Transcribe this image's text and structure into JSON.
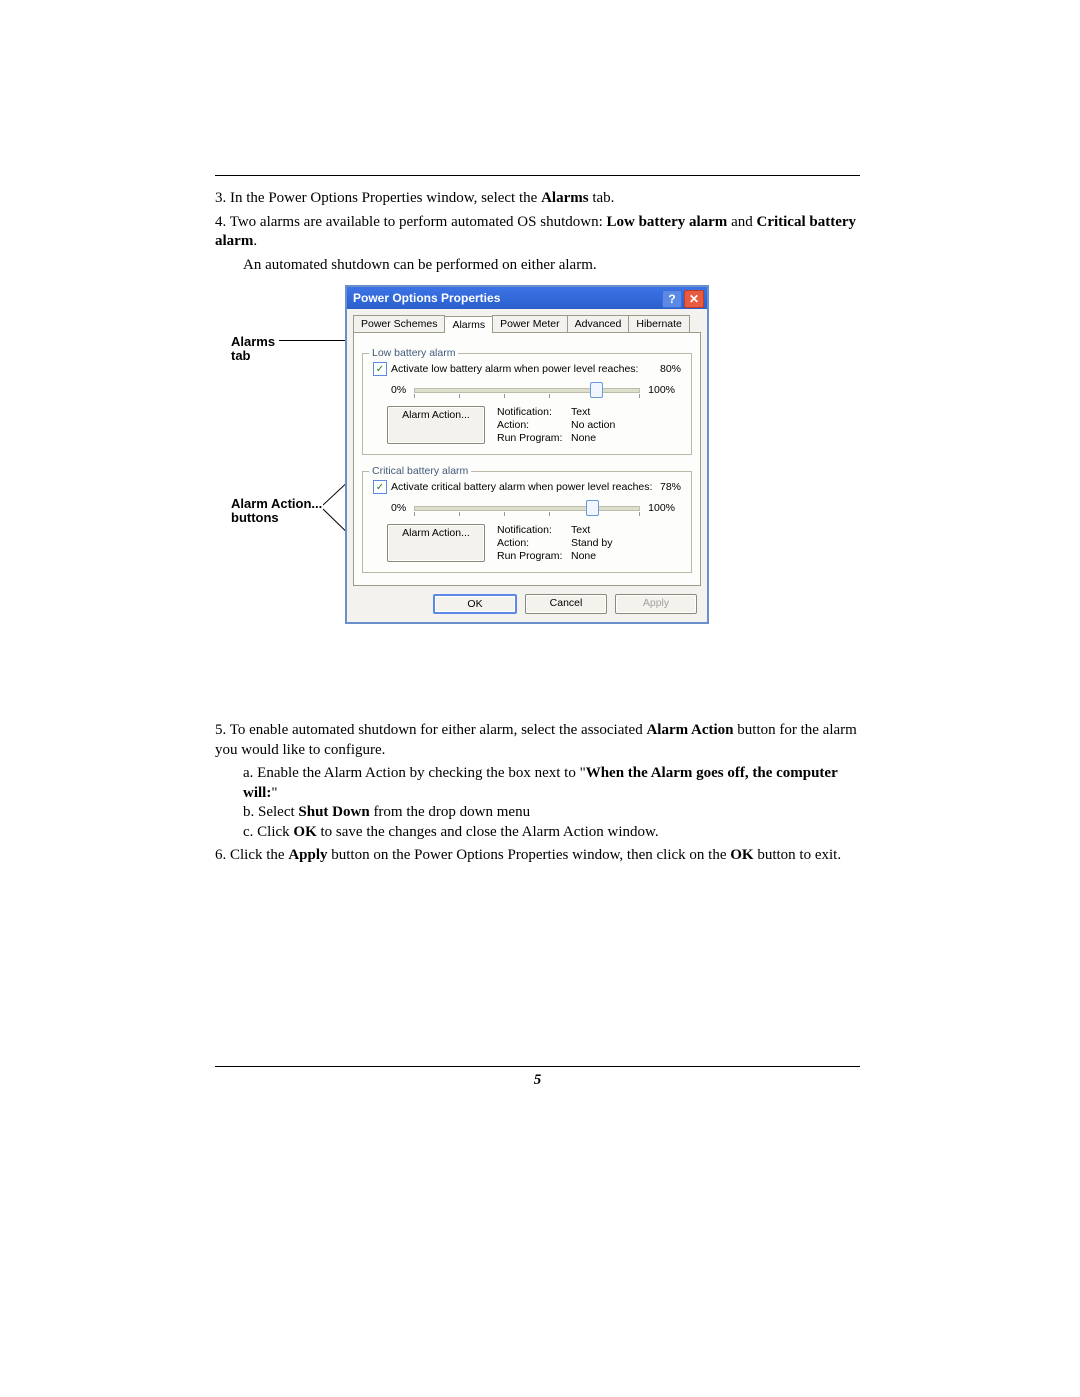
{
  "steps": {
    "s3_a": "3. In the Power Options Properties window, select the ",
    "s3_b": "Alarms",
    "s3_c": " tab.",
    "s4_a": "4. Two alarms are available to perform automated OS shutdown: ",
    "s4_b": "Low battery alarm",
    "s4_c": " and ",
    "s4_d": "Critical battery alarm",
    "s4_e": ".",
    "s4_f": "An automated shutdown can be performed on either alarm.",
    "s5_a": "5. To enable automated shutdown for either alarm, select the associated ",
    "s5_b": "Alarm Action",
    "s5_c": " button for the alarm you would like to configure.",
    "s5a_a": "a. Enable the Alarm Action by checking the box next to \"",
    "s5a_b": "When the Alarm goes off, the computer will:",
    "s5a_c": "\"",
    "s5b_a": "b. Select ",
    "s5b_b": "Shut Down",
    "s5b_c": " from the drop down menu",
    "s5c_a": "c.  Click ",
    "s5c_b": "OK",
    "s5c_c": " to save the changes and close the Alarm Action window.",
    "s6_a": "6. Click the ",
    "s6_b": "Apply",
    "s6_c": " button on the Power Options Properties window, then click on the ",
    "s6_d": "OK",
    "s6_e": " button to exit."
  },
  "callouts": {
    "alarms_tab_l1": "Alarms",
    "alarms_tab_l2": "tab",
    "action_l1": "Alarm Action...",
    "action_l2": "buttons"
  },
  "dialog": {
    "title": "Power Options Properties",
    "help_glyph": "?",
    "close_glyph": "✕",
    "tabs": {
      "t0": "Power Schemes",
      "t1": "Alarms",
      "t2": "Power Meter",
      "t3": "Advanced",
      "t4": "Hibernate"
    },
    "low": {
      "legend": "Low battery alarm",
      "check_label": "Activate low battery alarm when power level reaches:",
      "check_glyph": "✓",
      "pct": "80%",
      "min": "0%",
      "max": "100%",
      "thumb_left": "78%",
      "alarm_action_btn": "Alarm Action...",
      "notif_k": "Notification:",
      "notif_v": "Text",
      "action_k": "Action:",
      "action_v": "No action",
      "run_k": "Run Program:",
      "run_v": "None"
    },
    "crit": {
      "legend": "Critical battery alarm",
      "check_label": "Activate critical battery alarm when power level reaches:",
      "check_glyph": "✓",
      "pct": "78%",
      "min": "0%",
      "max": "100%",
      "thumb_left": "76%",
      "alarm_action_btn": "Alarm Action...",
      "notif_k": "Notification:",
      "notif_v": "Text",
      "action_k": "Action:",
      "action_v": "Stand by",
      "run_k": "Run Program:",
      "run_v": "None"
    },
    "footer": {
      "ok": "OK",
      "cancel": "Cancel",
      "apply": "Apply"
    }
  },
  "page_number": "5"
}
